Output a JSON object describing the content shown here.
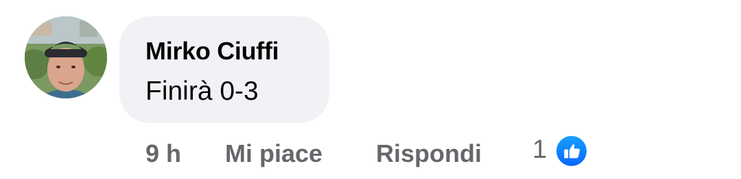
{
  "comment": {
    "author": "Mirko Ciuffi",
    "text": "Finirà 0-3",
    "time": "9 h",
    "like_label": "Mi piace",
    "reply_label": "Rispondi",
    "reaction_count": "1",
    "reaction_icon": "thumbs-up-icon"
  },
  "colors": {
    "bubble_bg": "#f0f2f5",
    "text": "#050505",
    "meta": "#65676b",
    "like_blue": "#0866ff"
  }
}
